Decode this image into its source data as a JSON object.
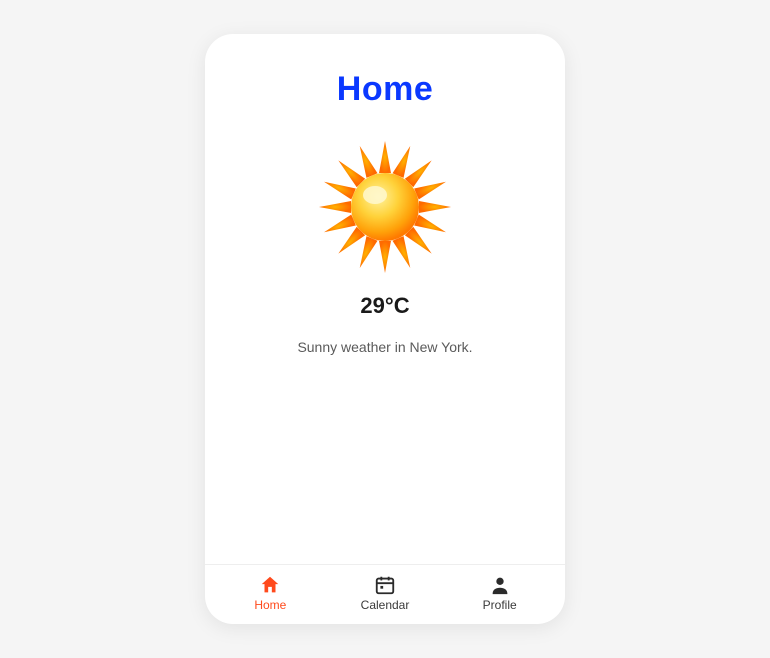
{
  "page": {
    "title": "Home"
  },
  "weather": {
    "icon": "sun-icon",
    "temperature": "29°C",
    "description": "Sunny weather in New York."
  },
  "tabbar": {
    "active_index": 0,
    "items": [
      {
        "label": "Home",
        "icon": "home-icon"
      },
      {
        "label": "Calendar",
        "icon": "calendar-icon"
      },
      {
        "label": "Profile",
        "icon": "profile-icon"
      }
    ]
  },
  "colors": {
    "accent": "#ff4a1c",
    "title": "#0a38ff"
  }
}
